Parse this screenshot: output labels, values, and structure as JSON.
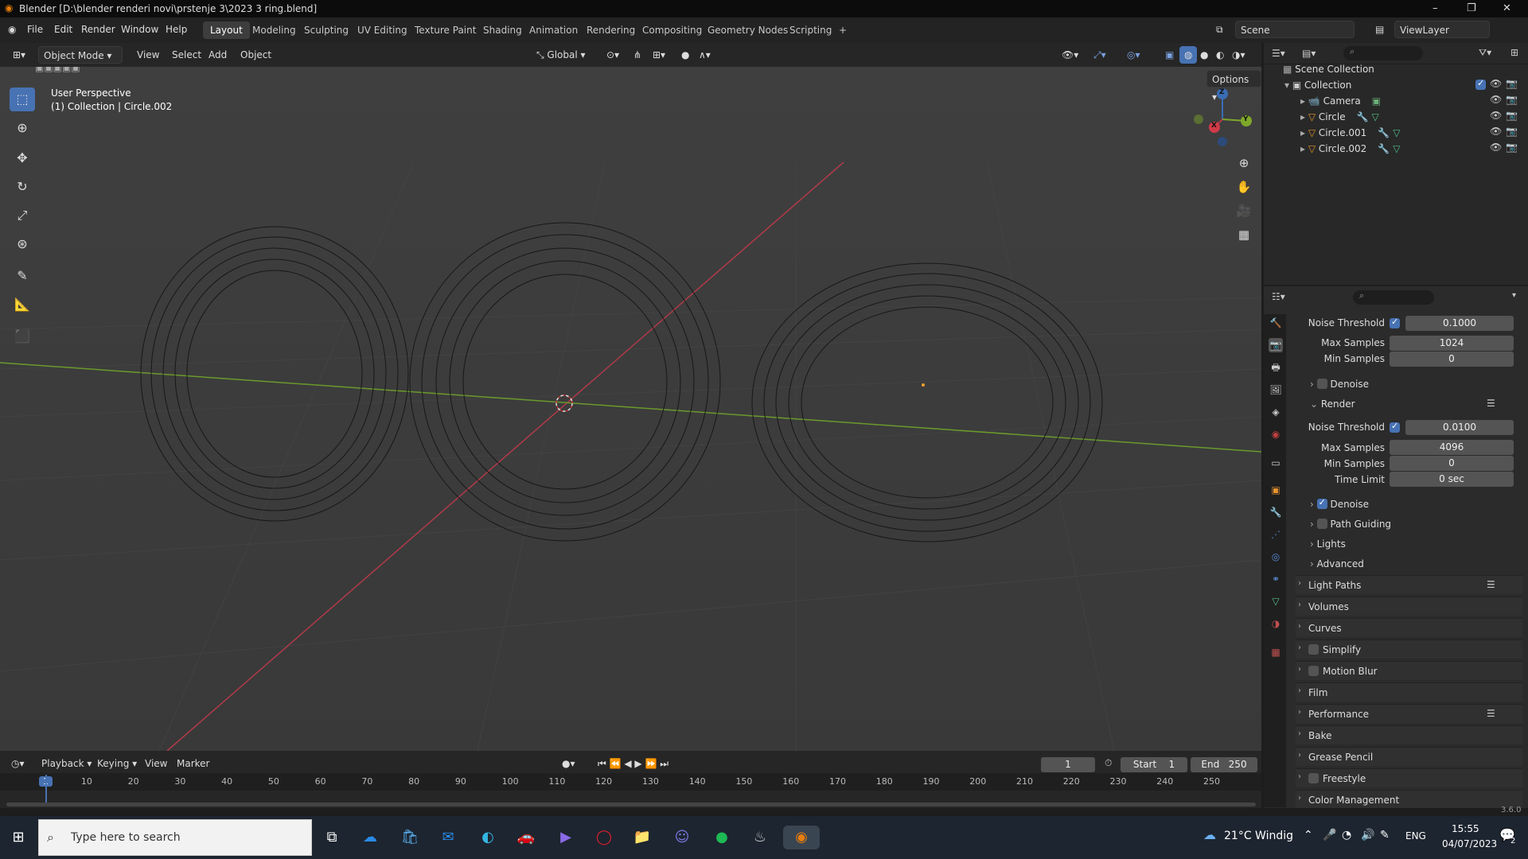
{
  "window": {
    "title": "Blender [D:\\blender renderi novi\\prstenje 3\\2023 3 ring.blend]",
    "minimize": "–",
    "restore": "❐",
    "close": "✕"
  },
  "menu": {
    "items": [
      "File",
      "Edit",
      "Render",
      "Window",
      "Help"
    ]
  },
  "workspaces": [
    "Layout",
    "Modeling",
    "Sculpting",
    "UV Editing",
    "Texture Paint",
    "Shading",
    "Animation",
    "Rendering",
    "Compositing",
    "Geometry Nodes",
    "Scripting",
    "+"
  ],
  "scene": {
    "name": "Scene",
    "view_layer": "ViewLayer"
  },
  "viewport_header": {
    "mode": "Object Mode",
    "menus": [
      "View",
      "Select",
      "Add",
      "Object"
    ],
    "orientation": "Global",
    "options": "Options"
  },
  "viewport": {
    "perspective": "User Perspective",
    "collection_info": "(1) Collection | Circle.002"
  },
  "gizmo": {
    "z": "Z",
    "x": "X",
    "y": "Y"
  },
  "outliner": {
    "search_placeholder": "",
    "scene_collection": "Scene Collection",
    "collection": "Collection",
    "objects": [
      "Camera",
      "Circle",
      "Circle.001",
      "Circle.002"
    ]
  },
  "properties": {
    "viewport_section": {
      "noise_threshold_label": "Noise Threshold",
      "noise_threshold": "0.1000",
      "max_samples_label": "Max Samples",
      "max_samples": "1024",
      "min_samples_label": "Min Samples",
      "min_samples": "0",
      "denoise": "Denoise"
    },
    "render_section": {
      "title": "Render",
      "noise_threshold_label": "Noise Threshold",
      "noise_threshold": "0.0100",
      "max_samples_label": "Max Samples",
      "max_samples": "4096",
      "min_samples_label": "Min Samples",
      "min_samples": "0",
      "time_limit_label": "Time Limit",
      "time_limit": "0 sec"
    },
    "subpanels": [
      "Denoise",
      "Path Guiding",
      "Lights",
      "Advanced"
    ],
    "panels": [
      "Light Paths",
      "Volumes",
      "Curves",
      "Simplify",
      "Motion Blur",
      "Film",
      "Performance",
      "Bake",
      "Grease Pencil",
      "Freestyle",
      "Color Management"
    ]
  },
  "timeline": {
    "menus": [
      "Playback",
      "Keying",
      "View",
      "Marker"
    ],
    "current_frame": "1",
    "start_label": "Start",
    "start": "1",
    "end_label": "End",
    "end": "250",
    "ticks": [
      "1",
      "10",
      "20",
      "30",
      "40",
      "50",
      "60",
      "70",
      "80",
      "90",
      "100",
      "110",
      "120",
      "130",
      "140",
      "150",
      "160",
      "170",
      "180",
      "190",
      "200",
      "210",
      "220",
      "230",
      "240",
      "250"
    ]
  },
  "status": {
    "version": "3.6.0"
  },
  "taskbar": {
    "search_placeholder": "Type here to search",
    "weather": "21°C  Windig",
    "language": "ENG",
    "time": "15:55",
    "date": "04/07/2023",
    "notifications": "2"
  },
  "colors": {
    "accent": "#4772b3",
    "x_axis": "#b23a48",
    "y_axis": "#6a9a2c",
    "background": "#3d3d3d"
  }
}
